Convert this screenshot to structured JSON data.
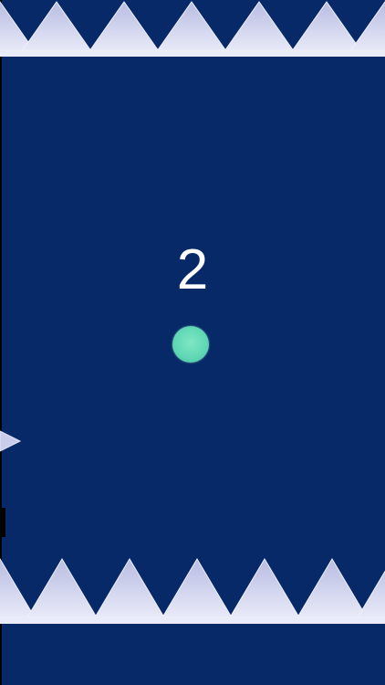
{
  "game": {
    "score": "2"
  },
  "colors": {
    "background": "#082968",
    "spike": "#c7cbea",
    "spike_light": "#e8eaf8",
    "ball": "#62d8b5",
    "score_text": "#ffffff"
  }
}
